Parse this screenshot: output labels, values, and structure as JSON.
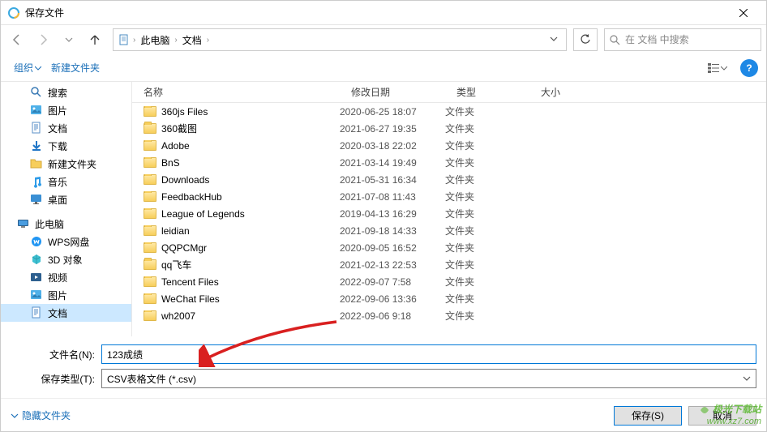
{
  "window": {
    "title": "保存文件"
  },
  "nav": {
    "breadcrumb": [
      "此电脑",
      "文档"
    ],
    "search_placeholder": "在 文档 中搜索"
  },
  "toolbar": {
    "organize": "组织",
    "new_folder": "新建文件夹"
  },
  "sidebar": {
    "items": [
      {
        "label": "搜索",
        "icon": "search"
      },
      {
        "label": "图片",
        "icon": "pictures"
      },
      {
        "label": "文档",
        "icon": "documents"
      },
      {
        "label": "下载",
        "icon": "downloads"
      },
      {
        "label": "新建文件夹",
        "icon": "folder"
      },
      {
        "label": "音乐",
        "icon": "music"
      },
      {
        "label": "桌面",
        "icon": "desktop"
      }
    ],
    "root": {
      "label": "此电脑",
      "icon": "pc"
    },
    "subitems": [
      {
        "label": "WPS网盘",
        "icon": "wps"
      },
      {
        "label": "3D 对象",
        "icon": "3d"
      },
      {
        "label": "视频",
        "icon": "videos"
      },
      {
        "label": "图片",
        "icon": "pictures"
      },
      {
        "label": "文档",
        "icon": "documents",
        "selected": true
      }
    ]
  },
  "columns": {
    "name": "名称",
    "date": "修改日期",
    "type": "类型",
    "size": "大小"
  },
  "files": [
    {
      "name": "360js Files",
      "date": "2020-06-25 18:07",
      "type": "文件夹"
    },
    {
      "name": "360截图",
      "date": "2021-06-27 19:35",
      "type": "文件夹"
    },
    {
      "name": "Adobe",
      "date": "2020-03-18 22:02",
      "type": "文件夹"
    },
    {
      "name": "BnS",
      "date": "2021-03-14 19:49",
      "type": "文件夹"
    },
    {
      "name": "Downloads",
      "date": "2021-05-31 16:34",
      "type": "文件夹"
    },
    {
      "name": "FeedbackHub",
      "date": "2021-07-08 11:43",
      "type": "文件夹"
    },
    {
      "name": "League of Legends",
      "date": "2019-04-13 16:29",
      "type": "文件夹"
    },
    {
      "name": "leidian",
      "date": "2021-09-18 14:33",
      "type": "文件夹"
    },
    {
      "name": "QQPCMgr",
      "date": "2020-09-05 16:52",
      "type": "文件夹"
    },
    {
      "name": "qq飞车",
      "date": "2021-02-13 22:53",
      "type": "文件夹"
    },
    {
      "name": "Tencent Files",
      "date": "2022-09-07 7:58",
      "type": "文件夹"
    },
    {
      "name": "WeChat Files",
      "date": "2022-09-06 13:36",
      "type": "文件夹"
    },
    {
      "name": "wh2007",
      "date": "2022-09-06 9:18",
      "type": "文件夹"
    }
  ],
  "form": {
    "filename_label": "文件名(N):",
    "filename_value": "123成绩",
    "filetype_label": "保存类型(T):",
    "filetype_value": "CSV表格文件 (*.csv)"
  },
  "footer": {
    "hide_folders": "隐藏文件夹",
    "save": "保存(S)",
    "cancel": "取消"
  },
  "watermark": {
    "name": "极光下载站",
    "url": "www.xz7.com"
  }
}
